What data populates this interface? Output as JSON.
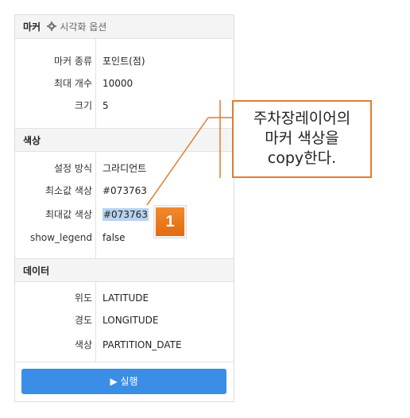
{
  "marker_section": {
    "title": "마커",
    "options_label": "시각화 옵션",
    "rows": [
      {
        "label": "마커 종류",
        "value": "포인트(점)"
      },
      {
        "label": "최대 개수",
        "value": "10000"
      },
      {
        "label": "크기",
        "value": "5"
      }
    ]
  },
  "color_section": {
    "title": "색상",
    "rows": [
      {
        "label": "설정 방식",
        "value": "그라디언트"
      },
      {
        "label": "최소값 색상",
        "value": "#073763"
      },
      {
        "label": "최대값 색상",
        "value": "#073763"
      },
      {
        "label": "show_legend",
        "value": "false"
      }
    ]
  },
  "data_section": {
    "title": "데이터",
    "rows": [
      {
        "label": "위도",
        "value": "LATITUDE"
      },
      {
        "label": "경도",
        "value": "LONGITUDE"
      },
      {
        "label": "색상",
        "value": "PARTITION_DATE"
      }
    ]
  },
  "run_button": {
    "label": "▶ 실행"
  },
  "annotation": {
    "badge": "1",
    "callout_lines": [
      "주차장레이어의",
      "마커 색상을",
      "copy한다."
    ]
  },
  "colors": {
    "accent": "#3a8ee6",
    "annotation": "#e07b2e",
    "selection": "#b7d3f0"
  }
}
